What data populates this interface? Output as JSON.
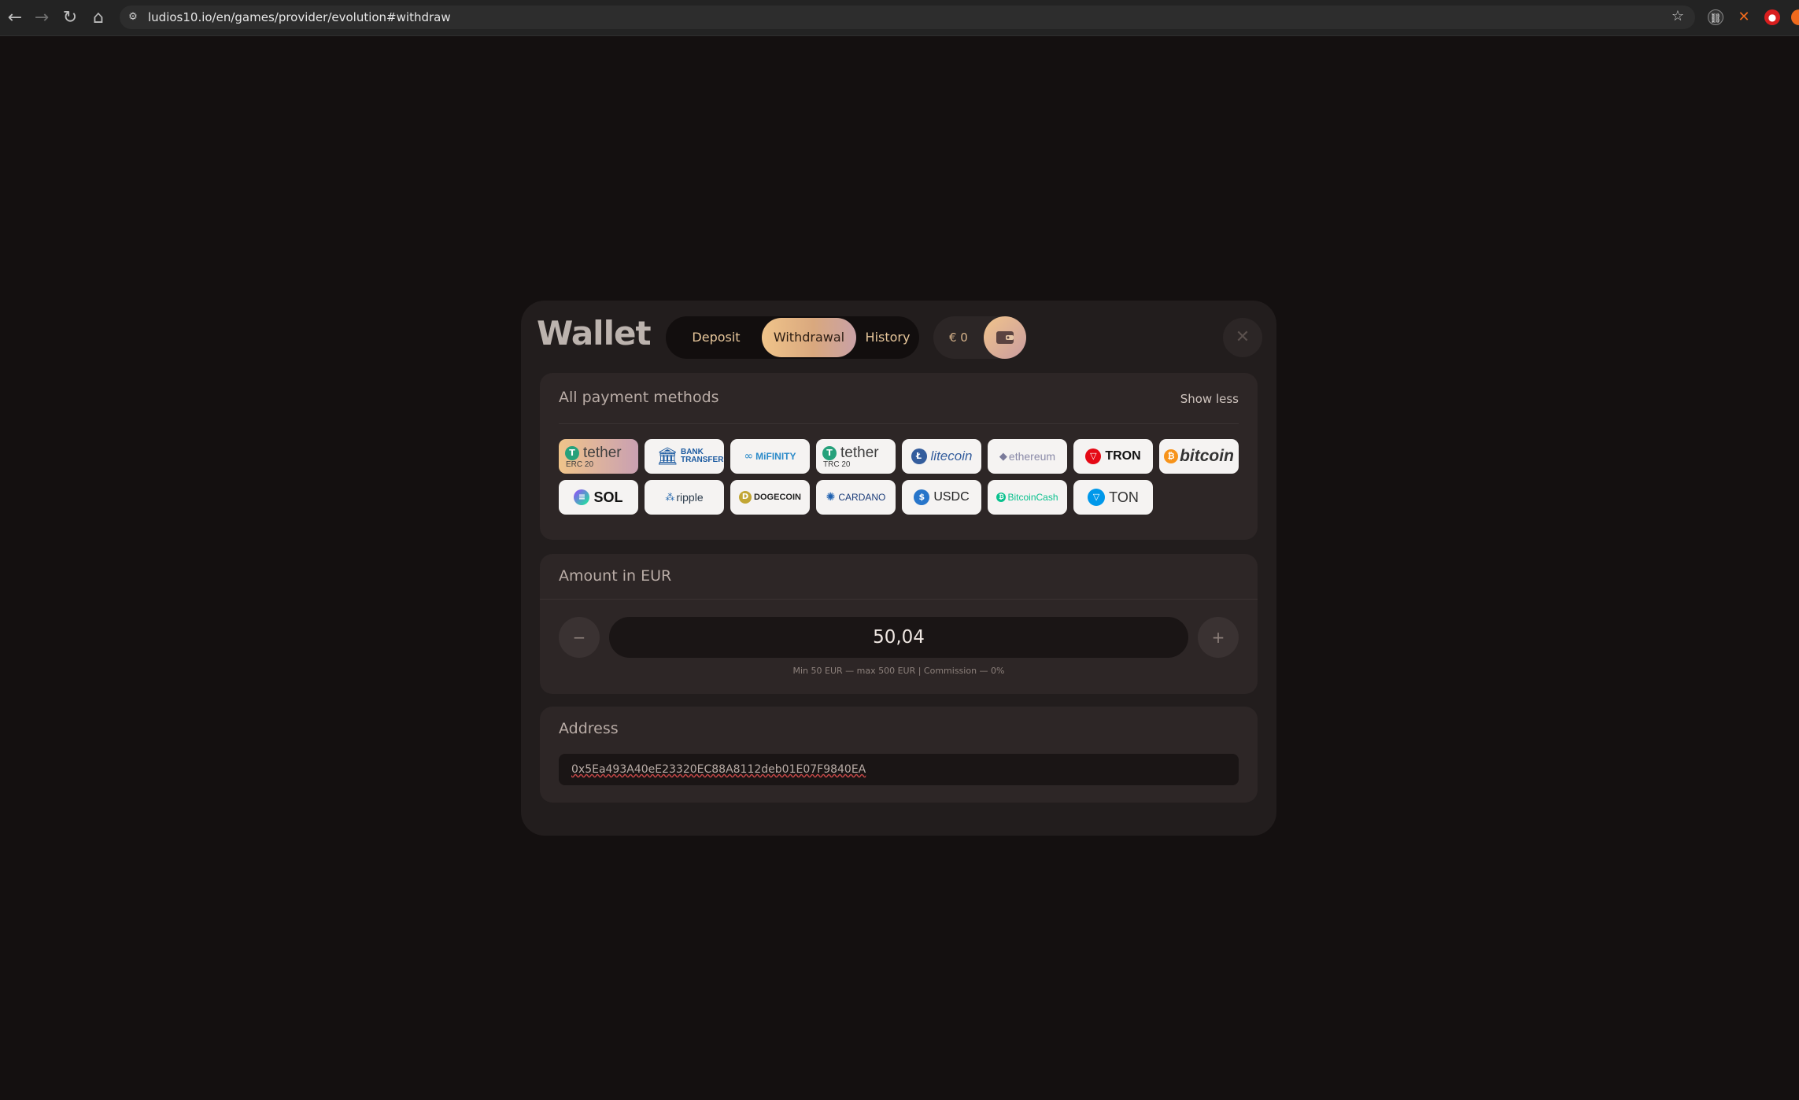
{
  "browser": {
    "url": "ludios10.io/en/games/provider/evolution#withdraw"
  },
  "wallet": {
    "title": "Wallet",
    "tabs": [
      {
        "label": "Deposit"
      },
      {
        "label": "Withdrawal",
        "active": true
      },
      {
        "label": "History"
      }
    ],
    "balance": "€ 0"
  },
  "payment_methods": {
    "heading": "All payment methods",
    "toggle_label": "Show less",
    "items": [
      {
        "label": "tether",
        "sub": "ERC 20",
        "icon": "tether-icon",
        "active": true
      },
      {
        "label": "BANK TRANSFER",
        "icon": "bank-icon"
      },
      {
        "label": "MiFINITY",
        "icon": "mifinity-icon"
      },
      {
        "label": "tether",
        "sub": "TRC 20",
        "icon": "tether-icon"
      },
      {
        "label": "litecoin",
        "icon": "litecoin-icon"
      },
      {
        "label": "ethereum",
        "icon": "ethereum-icon"
      },
      {
        "label": "TRON",
        "icon": "tron-icon"
      },
      {
        "label": "bitcoin",
        "icon": "bitcoin-icon"
      },
      {
        "label": "SOL",
        "icon": "solana-icon"
      },
      {
        "label": "ripple",
        "icon": "ripple-icon"
      },
      {
        "label": "DOGECOIN",
        "icon": "dogecoin-icon"
      },
      {
        "label": "CARDANO",
        "icon": "cardano-icon"
      },
      {
        "label": "USDC",
        "icon": "usdc-icon"
      },
      {
        "label": "BitcoinCash",
        "icon": "bitcoin-cash-icon"
      },
      {
        "label": "TON",
        "icon": "ton-icon"
      }
    ]
  },
  "amount": {
    "heading": "Amount in EUR",
    "value": "50,04",
    "minus": "−",
    "plus": "+",
    "limits": "Min 50 EUR — max 500 EUR | Commission — 0%"
  },
  "address": {
    "heading": "Address",
    "value": "0x5Ea493A40eE23320EC88A8112deb01E07F9840EA"
  },
  "colors": {
    "accent_start": "#f0c48a",
    "accent_end": "#c9a0b2",
    "modal_bg": "#221d1d",
    "page_bg": "#141010"
  }
}
